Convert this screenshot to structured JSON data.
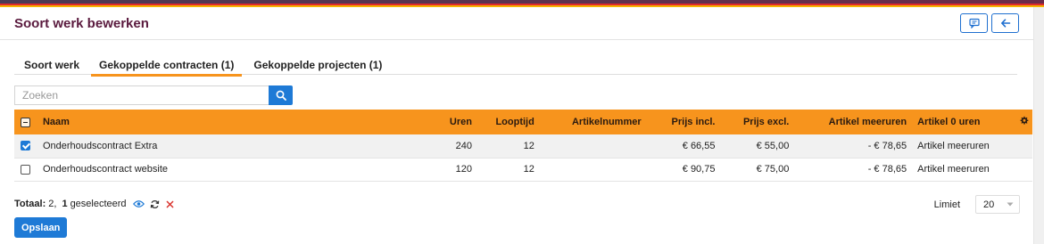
{
  "header": {
    "title": "Soort werk bewerken"
  },
  "tabs": [
    {
      "label": "Soort werk",
      "active": false
    },
    {
      "label": "Gekoppelde contracten (1)",
      "active": true
    },
    {
      "label": "Gekoppelde projecten (1)",
      "active": false
    }
  ],
  "search": {
    "placeholder": "Zoeken",
    "value": ""
  },
  "table": {
    "columns": [
      "Naam",
      "Uren",
      "Looptijd",
      "Artikelnummer",
      "Prijs incl.",
      "Prijs excl.",
      "Artikel meeruren",
      "Artikel 0 uren"
    ],
    "rows": [
      {
        "selected": true,
        "naam": "Onderhoudscontract Extra",
        "uren": "240",
        "looptijd": "12",
        "artikelnummer": "",
        "prijs_incl": "€ 66,55",
        "prijs_excl": "€ 55,00",
        "artikel_meeruren": "- € 78,65",
        "artikel_0_uren": "Artikel meeruren"
      },
      {
        "selected": false,
        "naam": "Onderhoudscontract website",
        "uren": "120",
        "looptijd": "12",
        "artikelnummer": "",
        "prijs_incl": "€ 90,75",
        "prijs_excl": "€ 75,00",
        "artikel_meeruren": "- € 78,65",
        "artikel_0_uren": "Artikel meeruren"
      }
    ]
  },
  "footer": {
    "total_label": "Totaal:",
    "total_count": "2,",
    "selected_count": "1",
    "selected_label": "geselecteerd"
  },
  "limit": {
    "label": "Limiet",
    "value": "20"
  },
  "save_label": "Opslaan",
  "colors": {
    "accent": "#f7941d",
    "primary": "#1e7ad6",
    "title": "#5a1a3e"
  }
}
